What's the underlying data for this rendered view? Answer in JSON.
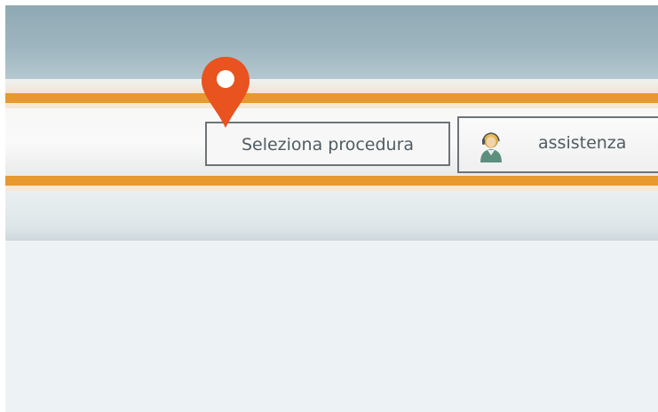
{
  "toolbar": {
    "procedure_button_label": "Seleziona procedura",
    "assistance_button_label": "assistenza"
  },
  "icons": {
    "assistance_icon": "support-person-icon",
    "pin_icon": "location-pin-icon"
  },
  "colors": {
    "header_band": "#9db5bf",
    "accent_line": "#e7982f",
    "button_border": "#6d7478",
    "button_text": "#4f5c63",
    "pin": "#e8531f",
    "content_background": "#edf2f4"
  }
}
